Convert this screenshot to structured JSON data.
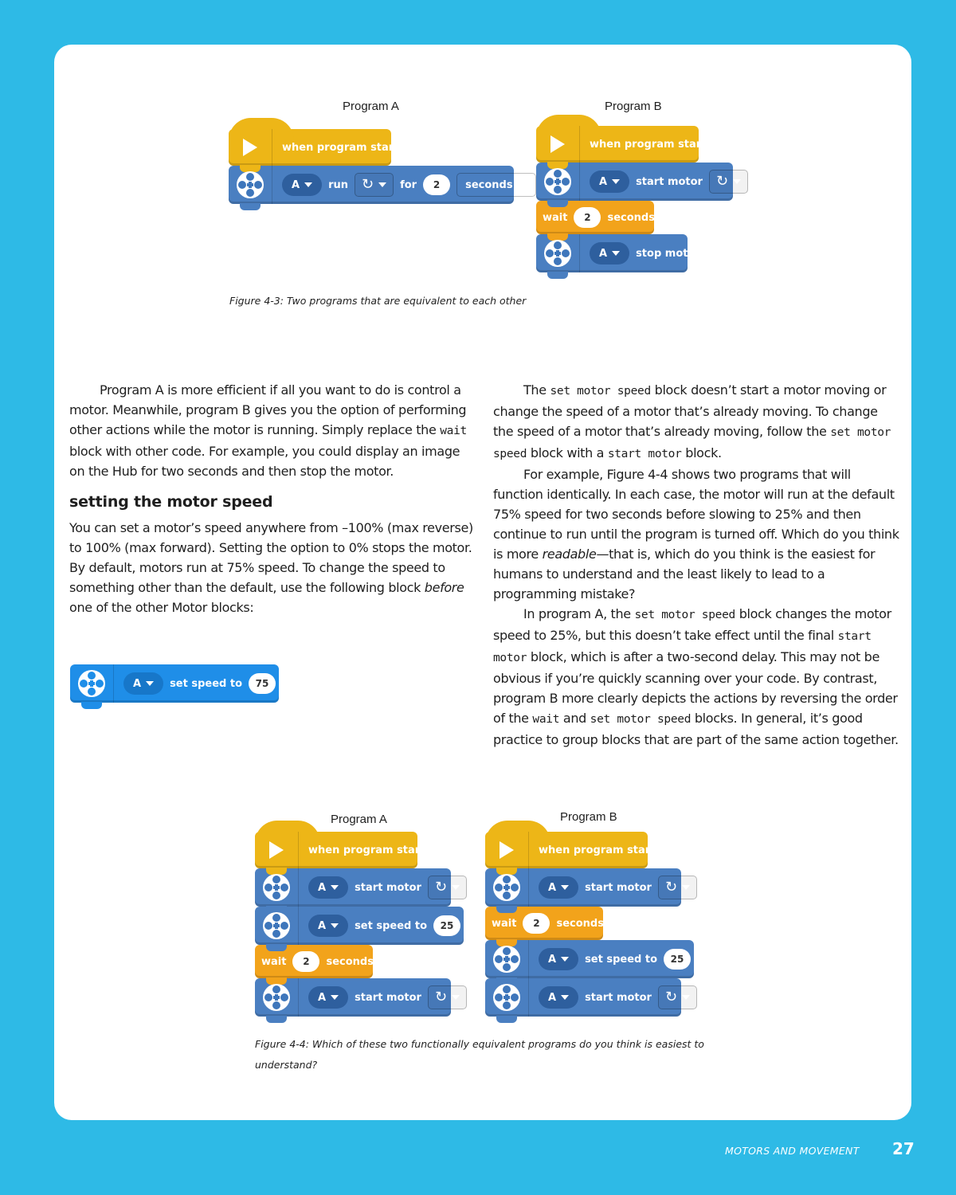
{
  "figure_4_3": {
    "program_a": {
      "label": "Program A",
      "blocks": {
        "hat": "when program starts",
        "run": {
          "port": "A",
          "verb": "run",
          "for": "for",
          "amount": "2",
          "unit": "seconds"
        }
      }
    },
    "program_b": {
      "label": "Program B",
      "blocks": {
        "hat": "when program starts",
        "start": {
          "port": "A",
          "verb": "start motor"
        },
        "wait": {
          "verb": "wait",
          "amount": "2",
          "unit": "seconds"
        },
        "stop": {
          "port": "A",
          "verb": "stop motor"
        }
      }
    },
    "caption": "Figure 4-3: Two programs that are equivalent to each other"
  },
  "left_column": {
    "para1": {
      "t1": "Program A is more efficient if all you want to do is control a motor. Meanwhile, program B gives you the option of performing other actions while the motor is running. Simply replace the ",
      "c1": "wait",
      "t2": " block with other code. For example, you could display an image on the Hub for two seconds and then stop the motor."
    },
    "heading": "setting the motor speed",
    "para2": {
      "t1": "You can set a motor’s speed anywhere from –100% (max reverse) to 100% (max forward). Setting the option to 0% stops the motor. By default, motors run at 75% speed. To change the speed to something other than the default, use the following block ",
      "em": "before",
      "t2": " one of the other Motor blocks:"
    },
    "speed_block": {
      "port": "A",
      "verb": "set speed to",
      "amount": "75",
      "unit": "%"
    }
  },
  "right_column": {
    "para1": {
      "t1": "The ",
      "c1": "set motor speed",
      "t2": " block doesn’t start a motor moving or change the speed of a motor that’s already moving. To change the speed of a motor that’s already moving, follow the ",
      "c2": "set motor speed",
      "t3": " block with a ",
      "c3": "start motor",
      "t4": " block."
    },
    "para2": {
      "t1": "For example, Figure 4-4 shows two programs that will function identically. In each case, the motor will run at the default 75% speed for two seconds before slowing to 25% and then continue to run until the program is turned off. Which do you think is more ",
      "em": "readable",
      "t2": "—that is, which do you think is the easiest for humans to understand and the least likely to lead to a programming mistake?"
    },
    "para3": {
      "t1": "In program A, the ",
      "c1": "set motor speed",
      "t2": " block changes the motor speed to 25%, but this doesn’t take effect until the final ",
      "c2": "start motor",
      "t3": " block, which is after a two-second delay. This may not be obvious if you’re quickly scanning over your code. By contrast, program B more clearly depicts the actions by reversing the order of the ",
      "c3": "wait",
      "t4": " and ",
      "c4": "set motor speed",
      "t5": " blocks. In general, it’s good practice to group blocks that are part of the same action together."
    }
  },
  "figure_4_4": {
    "program_a": {
      "label": "Program A",
      "blocks": {
        "hat": "when program starts",
        "start1": {
          "port": "A",
          "verb": "start motor"
        },
        "speed": {
          "port": "A",
          "verb": "set speed to",
          "amount": "25",
          "unit": "%"
        },
        "wait": {
          "verb": "wait",
          "amount": "2",
          "unit": "seconds"
        },
        "start2": {
          "port": "A",
          "verb": "start motor"
        }
      }
    },
    "program_b": {
      "label": "Program B",
      "blocks": {
        "hat": "when program starts",
        "start1": {
          "port": "A",
          "verb": "start motor"
        },
        "wait": {
          "verb": "wait",
          "amount": "2",
          "unit": "seconds"
        },
        "speed": {
          "port": "A",
          "verb": "set speed to",
          "amount": "25",
          "unit": "%"
        },
        "start2": {
          "port": "A",
          "verb": "start motor"
        }
      }
    },
    "caption": "Figure 4-4: Which of these two functionally equivalent programs do you think is easiest to understand?"
  },
  "footer": {
    "section": "MOTORS AND MOVEMENT",
    "page_number": "27"
  },
  "colors": {
    "page_background": "#2ebae6",
    "event_block": "#edb617",
    "motor_block": "#4a7fc1",
    "motor_block_bright": "#1f8ee8",
    "control_block": "#f2a31b"
  }
}
